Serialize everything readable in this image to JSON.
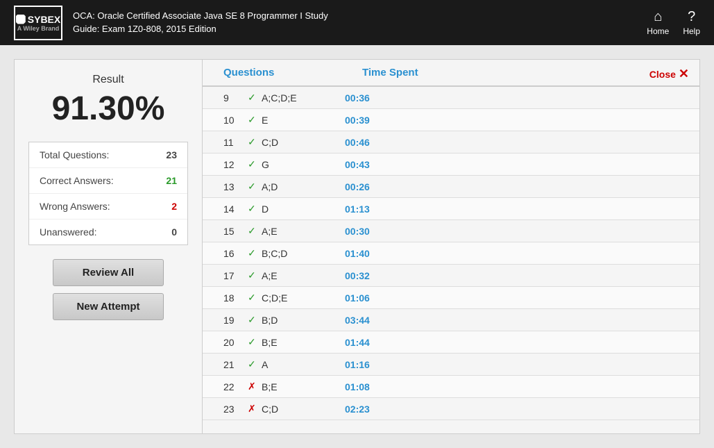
{
  "header": {
    "title": "OCA: Oracle Certified Associate Java SE 8 Programmer I Study Guide: Exam 1Z0-808, 2015 Edition",
    "logo": "SYBEX",
    "wiley": "A Wiley Brand",
    "nav": [
      {
        "label": "Home",
        "icon": "⌂",
        "name": "home-nav"
      },
      {
        "label": "Help",
        "icon": "?",
        "name": "help-nav"
      }
    ]
  },
  "result": {
    "label": "Result",
    "percent": "91.30%",
    "stats": [
      {
        "label": "Total Questions:",
        "value": "23",
        "type": "normal"
      },
      {
        "label": "Correct Answers:",
        "value": "21",
        "type": "green"
      },
      {
        "label": "Wrong Answers:",
        "value": "2",
        "type": "red"
      },
      {
        "label": "Unanswered:",
        "value": "0",
        "type": "normal"
      }
    ],
    "buttons": [
      {
        "label": "Review All",
        "name": "review-all-button"
      },
      {
        "label": "New Attempt",
        "name": "new-attempt-button"
      }
    ]
  },
  "table": {
    "col_questions": "Questions",
    "col_time": "Time Spent",
    "close_label": "Close",
    "rows": [
      {
        "num": "9",
        "status": "correct",
        "answer": "A;C;D;E",
        "time": "00:36"
      },
      {
        "num": "10",
        "status": "correct",
        "answer": "E",
        "time": "00:39"
      },
      {
        "num": "11",
        "status": "correct",
        "answer": "C;D",
        "time": "00:46"
      },
      {
        "num": "12",
        "status": "correct",
        "answer": "G",
        "time": "00:43"
      },
      {
        "num": "13",
        "status": "correct",
        "answer": "A;D",
        "time": "00:26"
      },
      {
        "num": "14",
        "status": "correct",
        "answer": "D",
        "time": "01:13"
      },
      {
        "num": "15",
        "status": "correct",
        "answer": "A;E",
        "time": "00:30"
      },
      {
        "num": "16",
        "status": "correct",
        "answer": "B;C;D",
        "time": "01:40"
      },
      {
        "num": "17",
        "status": "correct",
        "answer": "A;E",
        "time": "00:32"
      },
      {
        "num": "18",
        "status": "correct",
        "answer": "C;D;E",
        "time": "01:06"
      },
      {
        "num": "19",
        "status": "correct",
        "answer": "B;D",
        "time": "03:44"
      },
      {
        "num": "20",
        "status": "correct",
        "answer": "B;E",
        "time": "01:44"
      },
      {
        "num": "21",
        "status": "correct",
        "answer": "A",
        "time": "01:16"
      },
      {
        "num": "22",
        "status": "wrong",
        "answer": "B;E",
        "time": "01:08"
      },
      {
        "num": "23",
        "status": "wrong",
        "answer": "C;D",
        "time": "02:23"
      }
    ]
  }
}
